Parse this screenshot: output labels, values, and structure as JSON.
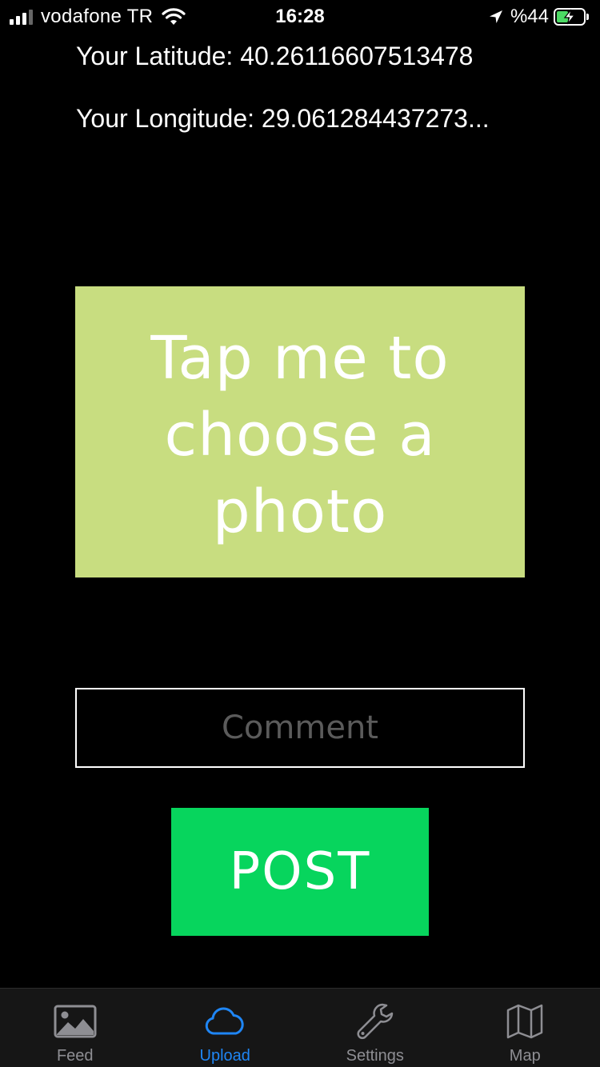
{
  "status_bar": {
    "carrier": "vodafone TR",
    "time": "16:28",
    "battery": "%44",
    "battery_level": 0.44,
    "signal_bars_active": 3,
    "signal_bars_total": 4
  },
  "location": {
    "latitude_text": "Your Latitude: 40.26116607513478",
    "longitude_text": "Your Longitude: 29.061284437273..."
  },
  "photo_picker": {
    "line1": "Tap me to",
    "line2": "choose a photo",
    "background": "#c8dd80"
  },
  "comment": {
    "value": "",
    "placeholder": "Comment"
  },
  "post_button": {
    "label": "POST",
    "color": "#07d55d"
  },
  "tab_bar": {
    "active_color": "#1f86f5",
    "inactive_color": "#8e8e93",
    "tabs": [
      {
        "label": "Feed",
        "icon": "photo-icon",
        "active": false
      },
      {
        "label": "Upload",
        "icon": "cloud-icon",
        "active": true
      },
      {
        "label": "Settings",
        "icon": "wrench-icon",
        "active": false
      },
      {
        "label": "Map",
        "icon": "map-icon",
        "active": false
      }
    ]
  }
}
